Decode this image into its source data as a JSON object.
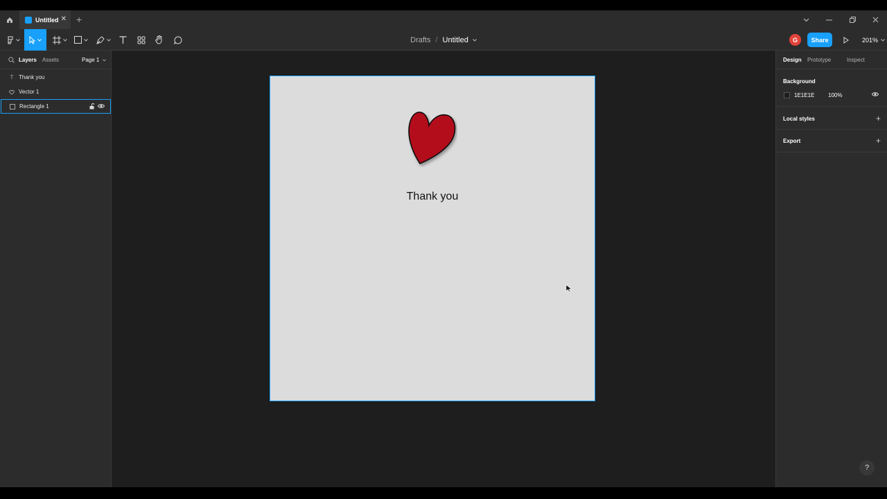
{
  "window": {
    "tab_title": "Untitled",
    "new_tab": "+",
    "close_tab": "✕"
  },
  "toolbar": {
    "breadcrumb_parent": "Drafts",
    "breadcrumb_separator": "/",
    "file_name": "Untitled",
    "avatar_initial": "G",
    "share_label": "Share",
    "zoom": "201%"
  },
  "left_panel": {
    "tabs": [
      "Layers",
      "Assets"
    ],
    "page": "Page 1",
    "layers": [
      {
        "name": "Thank you",
        "icon": "text-icon"
      },
      {
        "name": "Vector 1",
        "icon": "vector-icon"
      },
      {
        "name": "Rectangle 1",
        "icon": "rectangle-icon"
      }
    ]
  },
  "canvas": {
    "frame_text": "Thank you",
    "shape": "heart",
    "heart_color": "#b30e1e",
    "frame_color": "#dcdcdc"
  },
  "right_panel": {
    "tabs": [
      "Design",
      "Prototype",
      "Inspect"
    ],
    "background": {
      "heading": "Background",
      "hex": "1E1E1E",
      "opacity": "100%"
    },
    "local_styles": "Local styles",
    "export": "Export"
  },
  "help": "?",
  "colors": {
    "accent": "#18a0fb",
    "panel": "#2c2c2c",
    "canvas": "#1e1e1e",
    "avatar": "#e2443a"
  }
}
